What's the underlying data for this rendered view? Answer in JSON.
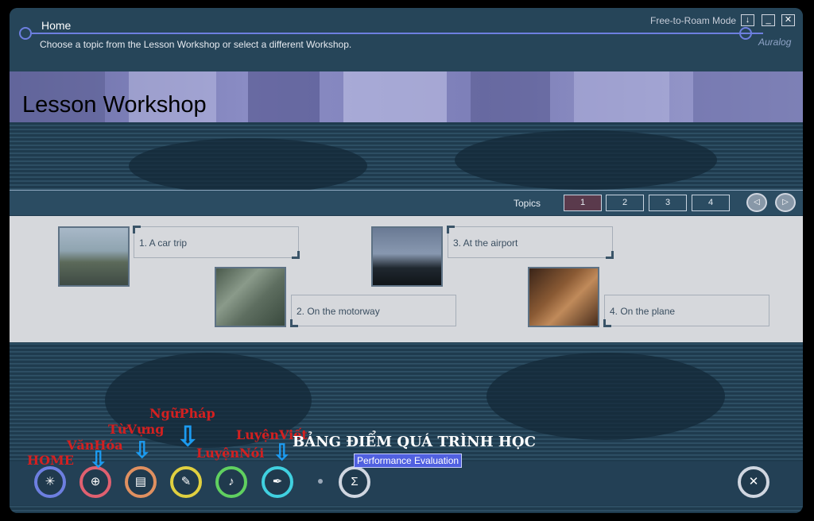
{
  "window": {
    "home_label": "Home",
    "subtitle": "Choose a topic from the Lesson Workshop or select a different Workshop.",
    "mode_label": "Free-to-Roam Mode",
    "download_btn": "↓",
    "minimize_btn": "_",
    "close_btn": "✕",
    "brand": "Auralog"
  },
  "banner": {
    "title": "Lesson Workshop"
  },
  "topics_bar": {
    "label": "Topics",
    "pages": [
      "1",
      "2",
      "3",
      "4"
    ],
    "active_page": "1",
    "prev_glyph": "◁",
    "next_glyph": "▷"
  },
  "topics": [
    {
      "label": "1. A car trip"
    },
    {
      "label": "2. On the motorway"
    },
    {
      "label": "3. At the airport"
    },
    {
      "label": "4. On the plane"
    }
  ],
  "annotations": {
    "home": "HOME",
    "culture": "VănHóa",
    "vocabulary": "TừVựng",
    "grammar": "NgữPháp",
    "speaking": "LuyệnNói",
    "writing": "LuyệnViết",
    "score_title": "BẢNG ĐIỂM QUÁ TRÌNH HỌC",
    "arrow": "⇩"
  },
  "toolbar": {
    "performance_tooltip": "Performance Evaluation",
    "icons": {
      "home": "home-network-icon",
      "culture": "globe-icon",
      "vocabulary": "book-icon",
      "grammar": "pen-scribble-icon",
      "speaking": "microphone-icon",
      "writing": "fountain-pen-icon",
      "performance": "sigma-icon",
      "exit": "exit-icon"
    },
    "glyphs": {
      "home": "✳",
      "culture": "⊕",
      "vocabulary": "▤",
      "grammar": "✎",
      "speaking": "♪",
      "writing": "✒",
      "performance": "Σ",
      "exit": "✕"
    }
  },
  "colors": {
    "accent": "#6d7fe0",
    "active_page": "#5a3a4c",
    "annotation_red": "#d42020",
    "annotation_arrow": "#1c9bf0",
    "tooltip_bg": "#5060e0"
  }
}
